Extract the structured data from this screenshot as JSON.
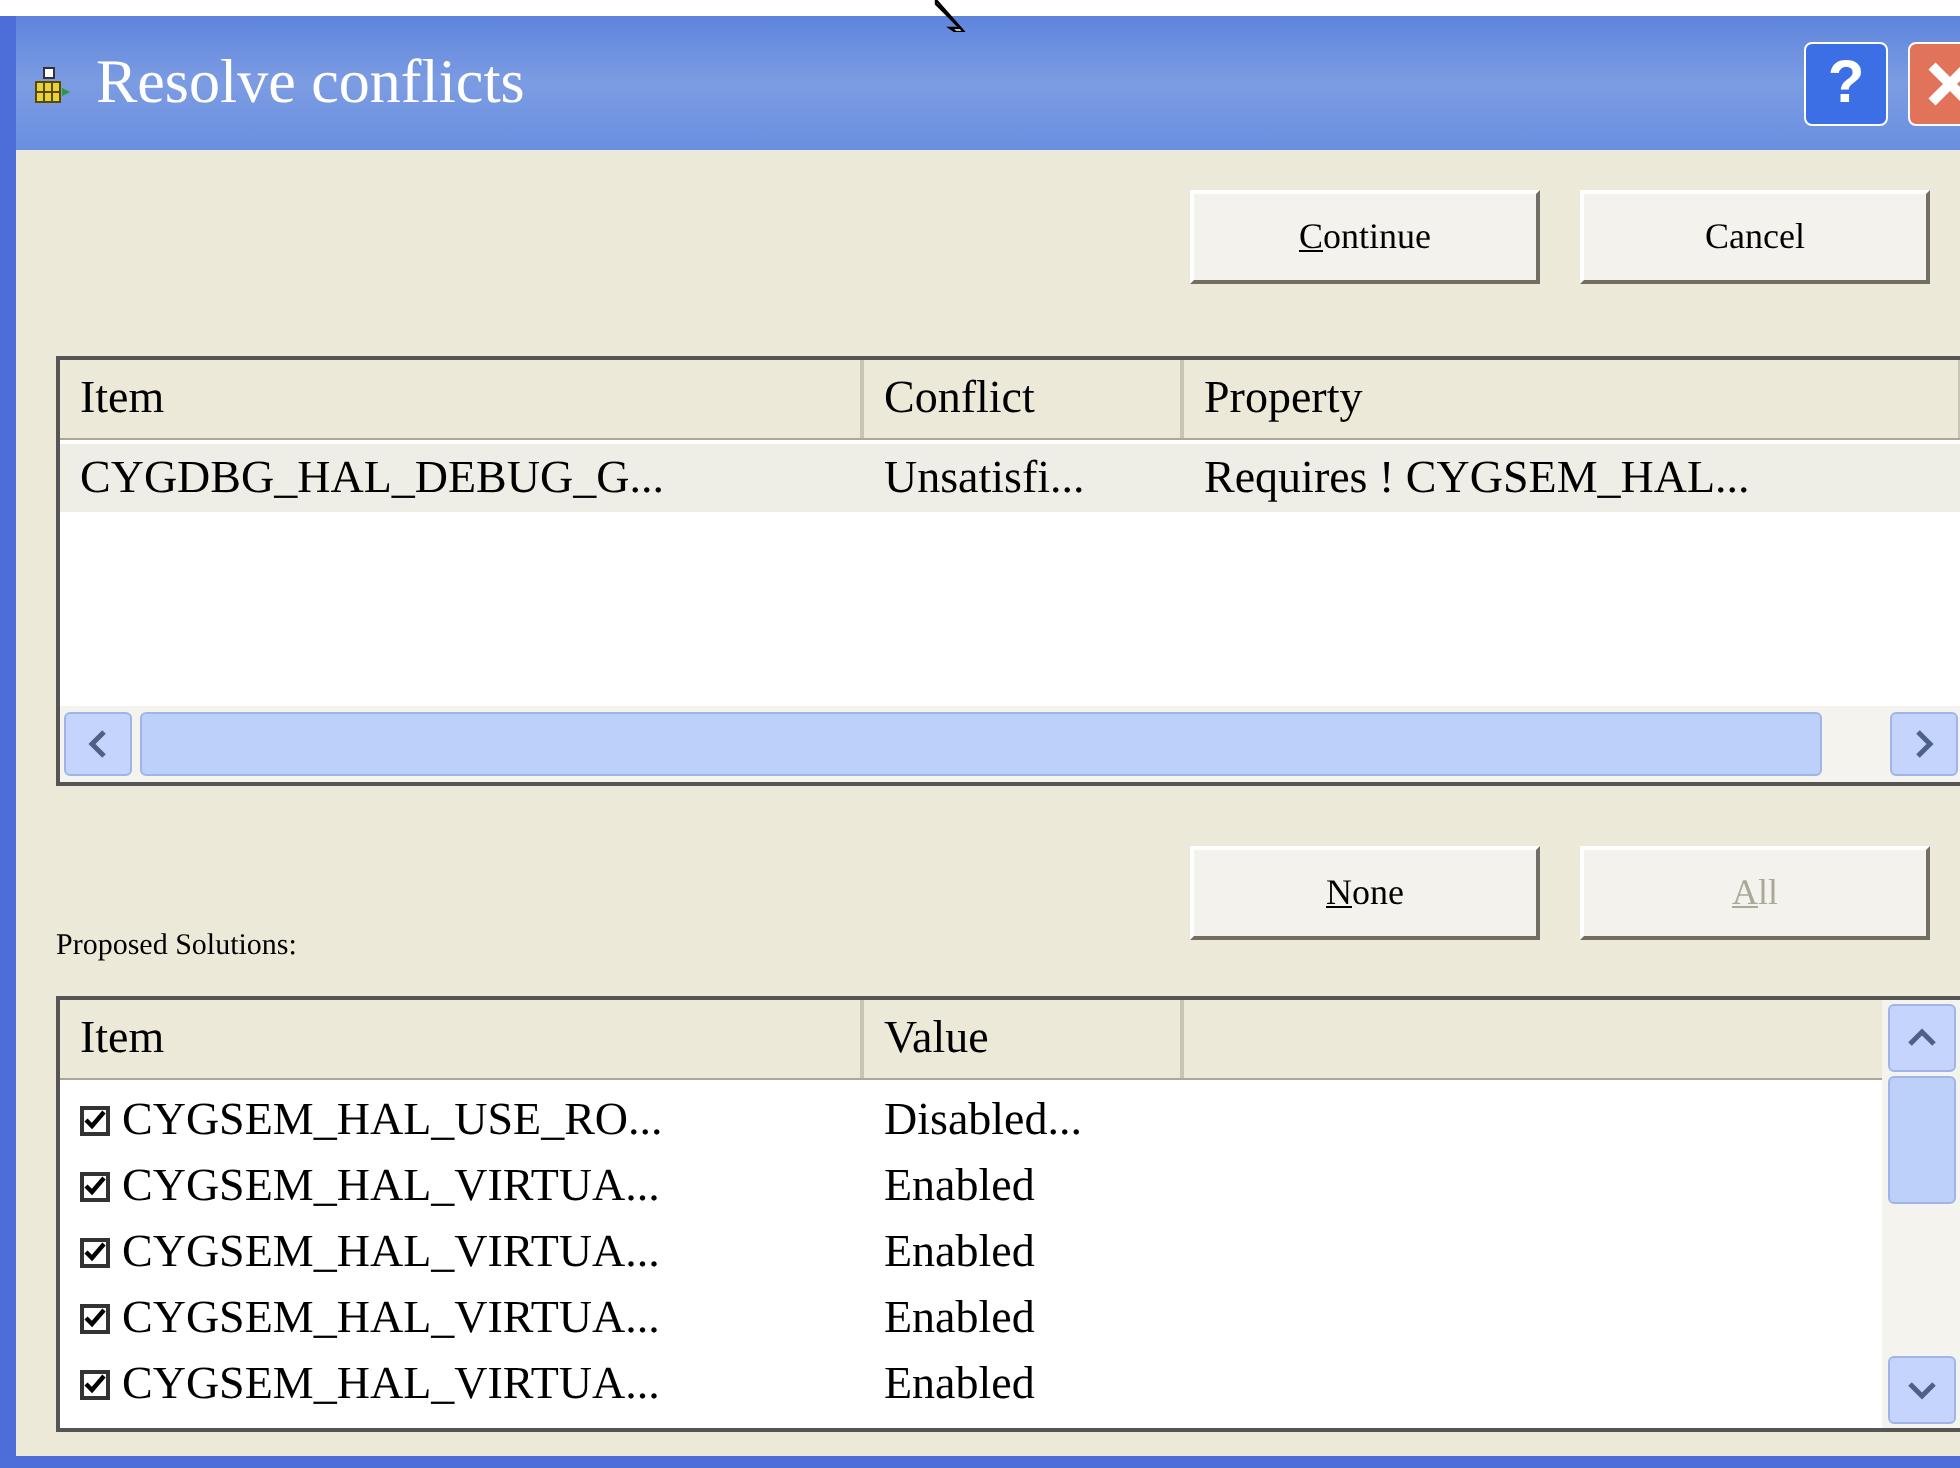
{
  "window": {
    "title": "Resolve conflicts",
    "help_button": "?"
  },
  "top_buttons": [
    {
      "accel": "C",
      "rest": "ontinue",
      "disabled": false
    },
    {
      "rest": "Cancel",
      "disabled": false
    }
  ],
  "conflicts": {
    "columns": [
      "Item",
      "Conflict",
      "Property"
    ],
    "rows": [
      {
        "selected": true,
        "cells": [
          "CYGDBG_HAL_DEBUG_G...",
          "Unsatisfi...",
          "Requires ! CYGSEM_HAL..."
        ]
      }
    ]
  },
  "solution_buttons": [
    {
      "accel": "N",
      "rest": "one",
      "disabled": false
    },
    {
      "accel": "A",
      "rest": "ll",
      "disabled": true
    }
  ],
  "solutions_label": "Proposed Solutions:",
  "solutions": {
    "columns": [
      "Item",
      "Value"
    ],
    "rows": [
      {
        "checked": true,
        "cells": [
          "CYGSEM_HAL_USE_RO...",
          "Disabled..."
        ]
      },
      {
        "checked": true,
        "cells": [
          "CYGSEM_HAL_VIRTUA...",
          "Enabled"
        ]
      },
      {
        "checked": true,
        "cells": [
          "CYGSEM_HAL_VIRTUA...",
          "Enabled"
        ]
      },
      {
        "checked": true,
        "cells": [
          "CYGSEM_HAL_VIRTUA...",
          "Enabled"
        ]
      },
      {
        "checked": true,
        "cells": [
          "CYGSEM_HAL_VIRTUA...",
          "Enabled"
        ]
      }
    ]
  }
}
